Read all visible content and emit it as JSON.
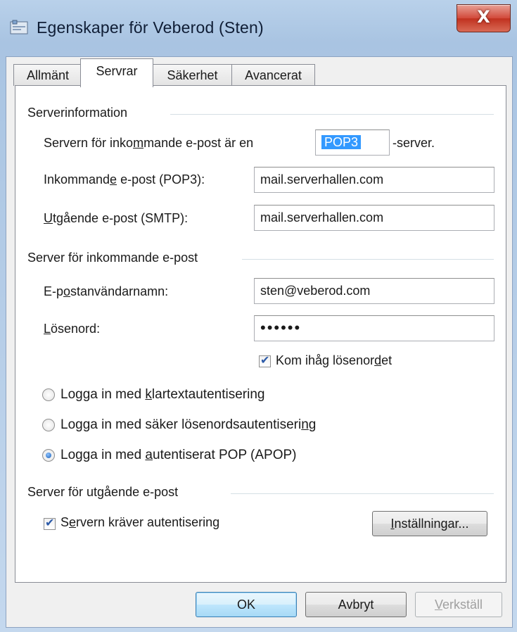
{
  "window": {
    "title": "Egenskaper för Veberod (Sten)",
    "close_glyph": "X"
  },
  "tabs": [
    {
      "label": "Allmänt",
      "active": false
    },
    {
      "label": "Servrar",
      "active": true
    },
    {
      "label": "Säkerhet",
      "active": false
    },
    {
      "label": "Avancerat",
      "active": false
    }
  ],
  "serverinfo": {
    "group_label": "Serverinformation",
    "incoming_type_prefix": "Servern för inko",
    "incoming_type_underlined": "m",
    "incoming_type_middle": "mande e-post är en",
    "incoming_type_value": "POP3",
    "incoming_type_suffix": "-server.",
    "incoming_label_a": "Inkommand",
    "incoming_label_u": "e",
    "incoming_label_b": " e-post (POP3):",
    "incoming_value": "mail.serverhallen.com",
    "outgoing_label_u": "U",
    "outgoing_label_b": "tgående e-post (SMTP):",
    "outgoing_value": "mail.serverhallen.com"
  },
  "incoming": {
    "group_label": "Server för inkommande e-post",
    "username_label_a": "E-p",
    "username_label_u": "o",
    "username_label_b": "stanvändarnamn:",
    "username_value": "sten@veberod.com",
    "password_label_u": "L",
    "password_label_b": "ösenord:",
    "password_value": "••••••",
    "remember_a": "Kom ihåg lösenor",
    "remember_u": "d",
    "remember_b": "et",
    "remember_checked": true,
    "auth_options": [
      {
        "a": "Logga in med ",
        "u": "k",
        "b": "lartextautentisering",
        "selected": false
      },
      {
        "a": "Logga in med säker lösenordsautentiseri",
        "u": "n",
        "b": "g",
        "selected": false
      },
      {
        "a": "Logga in med ",
        "u": "a",
        "b": "utentiserat POP (APOP)",
        "selected": true
      }
    ]
  },
  "outgoing": {
    "group_label": "Server för utgående e-post",
    "requires_auth_a": "S",
    "requires_auth_u": "e",
    "requires_auth_b": "rvern kräver autentisering",
    "requires_auth_checked": true,
    "settings_u": "I",
    "settings_b": "nställningar..."
  },
  "buttons": {
    "ok": "OK",
    "cancel": "Avbryt",
    "apply_u": "V",
    "apply_b": "erkställ"
  },
  "colors": {
    "accent": "#3399ff",
    "close": "#c0311f"
  }
}
